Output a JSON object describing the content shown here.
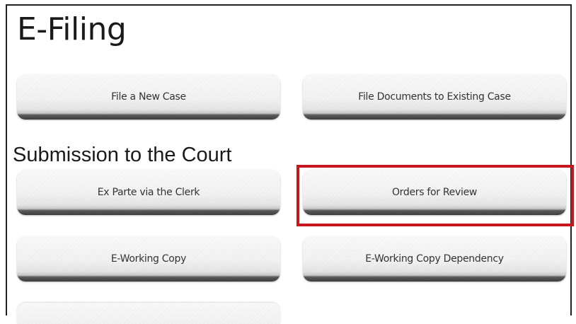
{
  "page": {
    "title": "E-Filing",
    "section_title": "Submission to the Court"
  },
  "buttons": {
    "file_new_case": "File a New Case",
    "file_existing_case": "File Documents to Existing Case",
    "ex_parte": "Ex Parte via the Clerk",
    "orders_review": "Orders for Review",
    "e_working_copy": "E-Working Copy",
    "e_working_copy_dependency": "E-Working Copy Dependency"
  },
  "colors": {
    "highlight_border": "#c8161d"
  }
}
